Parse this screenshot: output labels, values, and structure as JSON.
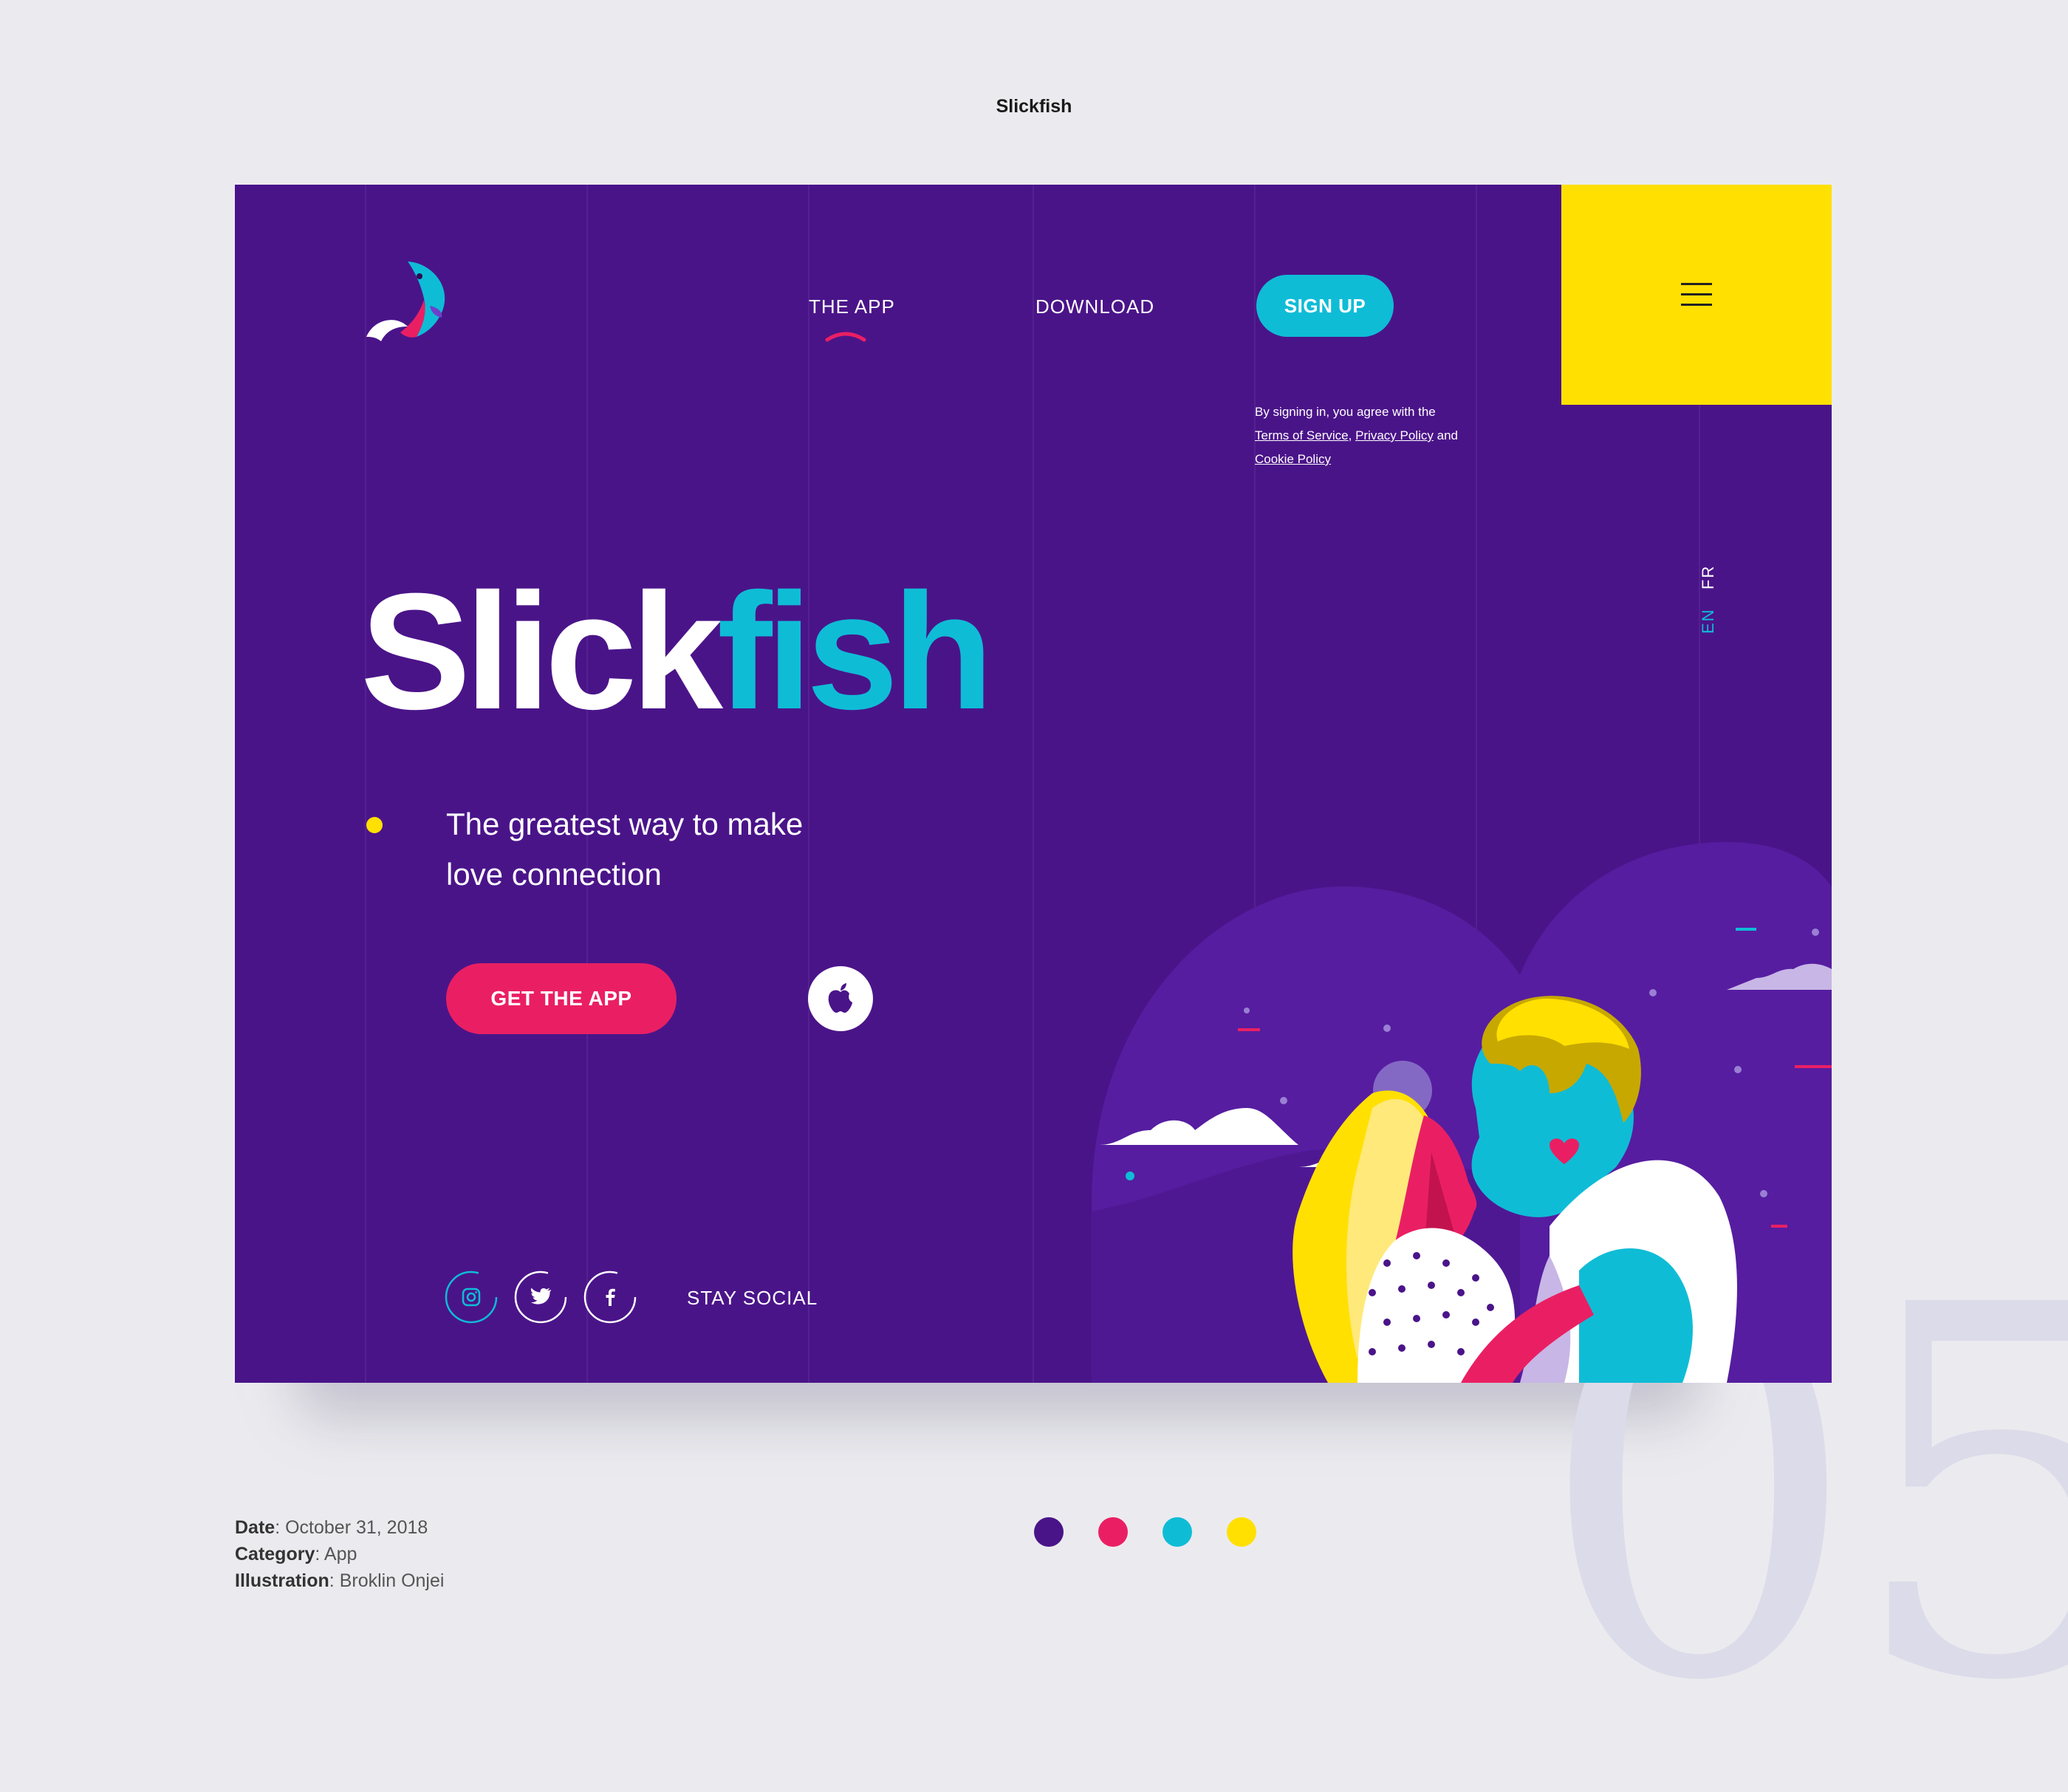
{
  "page": {
    "title": "Slickfish"
  },
  "watermark": "05",
  "nav": {
    "items": [
      {
        "label": "THE APP",
        "active": true
      },
      {
        "label": "DOWNLOAD",
        "active": false
      }
    ],
    "signup_label": "SIGN UP"
  },
  "legal": {
    "prefix": "By signing in, you agree with the",
    "terms": "Terms of Service",
    "sep": ",",
    "privacy": "Privacy Policy",
    "and": "and",
    "cookie": "Cookie Policy"
  },
  "language": {
    "en": "EN",
    "fr": "FR",
    "active": "EN"
  },
  "hero": {
    "brand_part1": "Slick",
    "brand_part2": "fish",
    "tagline_line1": "The greatest way to make",
    "tagline_line2": "love connection",
    "cta_label": "GET THE APP"
  },
  "social": {
    "icons": [
      "instagram-icon",
      "twitter-icon",
      "facebook-icon"
    ],
    "label": "STAY SOCIAL"
  },
  "meta": {
    "date_label": "Date",
    "date_value": "October 31, 2018",
    "category_label": "Category",
    "category_value": "App",
    "illustration_label": "Illustration",
    "illustration_value": "Broklin Onjei"
  },
  "palette": [
    "#4a1489",
    "#ea1f63",
    "#0fbcd6",
    "#ffe000"
  ],
  "colors": {
    "hero_bg": "#4a1489",
    "accent_cyan": "#0fbcd6",
    "accent_pink": "#ea1f63",
    "accent_yellow": "#ffe000"
  }
}
